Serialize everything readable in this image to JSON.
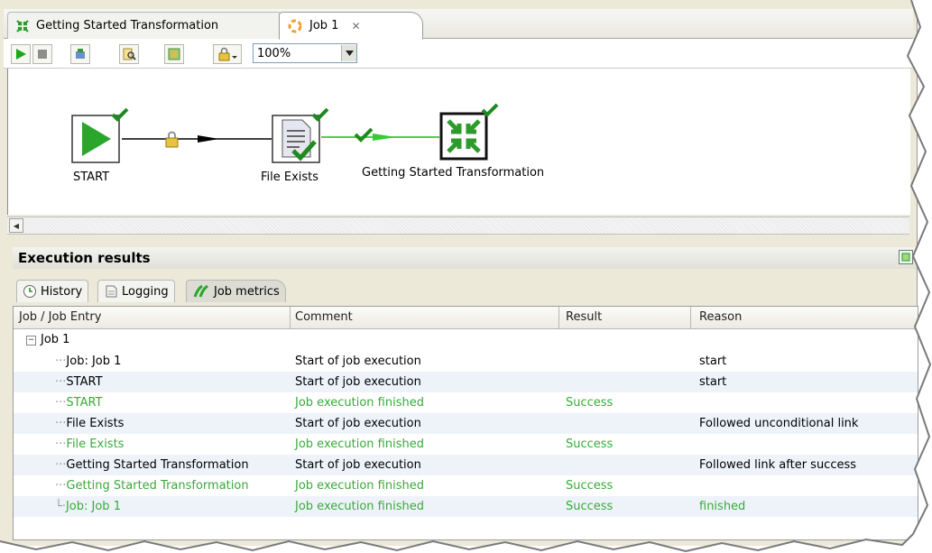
{
  "tabs": [
    {
      "label": "Getting Started Transformation",
      "icon": "transformation-icon"
    },
    {
      "label": "Job 1",
      "icon": "job-icon",
      "close": "✕"
    }
  ],
  "toolbar": {
    "zoom_value": "100%",
    "buttons": [
      "run-icon",
      "stop-icon",
      "replay-icon",
      "preview-icon",
      "impact-icon",
      "lock-icon"
    ]
  },
  "canvas": {
    "nodes": [
      {
        "label": "START",
        "icon": "start-icon"
      },
      {
        "label": "File Exists",
        "icon": "file-exists-icon"
      },
      {
        "label": "Getting Started Transformation",
        "icon": "transformation-icon"
      }
    ],
    "hops": [
      {
        "type": "unconditional",
        "icon": "lock-icon",
        "color": "#000000"
      },
      {
        "type": "success",
        "icon": "check-icon",
        "color": "#33cc33"
      }
    ]
  },
  "execution": {
    "title": "Execution results",
    "tabs": [
      {
        "label": "History",
        "icon": "history-icon"
      },
      {
        "label": "Logging",
        "icon": "logging-icon"
      },
      {
        "label": "Job metrics",
        "icon": "job-metrics-icon",
        "active": true
      }
    ]
  },
  "table": {
    "columns": [
      "Job / Job Entry",
      "Comment",
      "Result",
      "Reason"
    ],
    "root": "Job 1",
    "rows": [
      {
        "entry": "Job: Job 1",
        "comment": "Start of job execution",
        "result": "",
        "reason": "start",
        "green": false
      },
      {
        "entry": "START",
        "comment": "Start of job execution",
        "result": "",
        "reason": "start",
        "green": false
      },
      {
        "entry": "START",
        "comment": "Job execution finished",
        "result": "Success",
        "reason": "",
        "green": true
      },
      {
        "entry": "File Exists",
        "comment": "Start of job execution",
        "result": "",
        "reason": "Followed unconditional link",
        "green": false
      },
      {
        "entry": "File Exists",
        "comment": "Job execution finished",
        "result": "Success",
        "reason": "",
        "green": true
      },
      {
        "entry": "Getting Started Transformation",
        "comment": "Start of job execution",
        "result": "",
        "reason": "Followed link after success",
        "green": false
      },
      {
        "entry": "Getting Started Transformation",
        "comment": "Job execution finished",
        "result": "Success",
        "reason": "",
        "green": true
      },
      {
        "entry": "Job: Job 1",
        "comment": "Job execution finished",
        "result": "Success",
        "reason": "finished",
        "green": true
      }
    ]
  },
  "colors": {
    "success_green": "#3aa93a",
    "hop_green": "#33cc33",
    "check_green": "#1f8a1f",
    "row_alt": "#eef3fa"
  }
}
